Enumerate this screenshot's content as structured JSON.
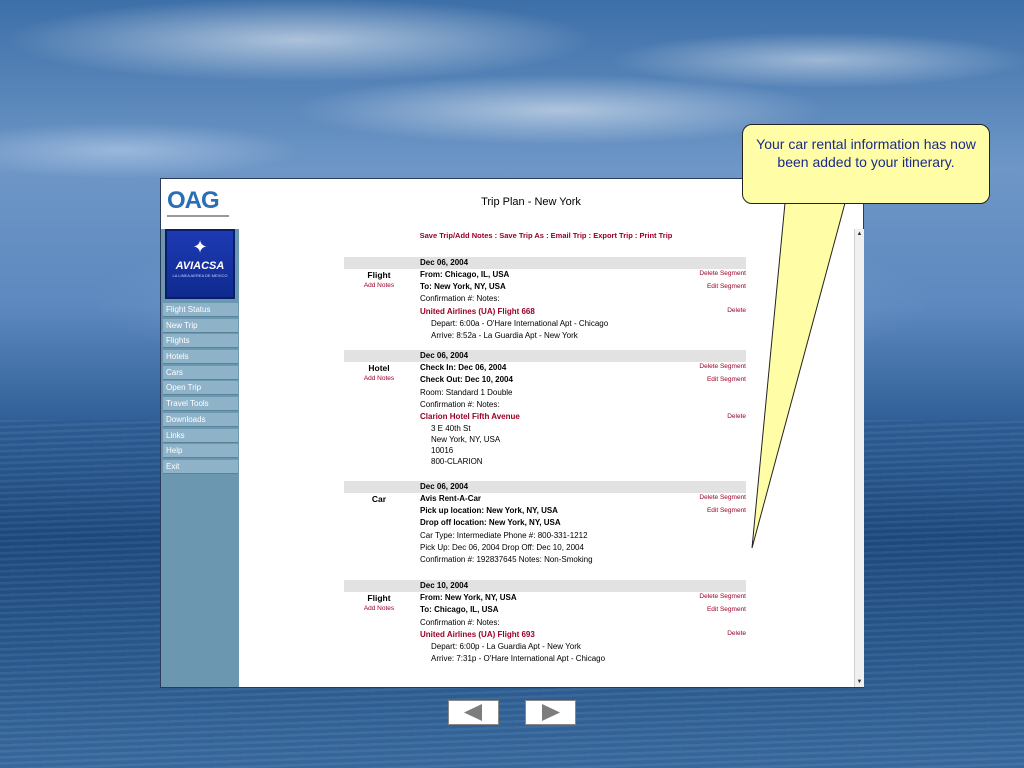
{
  "app": {
    "logo": "OAG",
    "airline": {
      "name": "AVIACSA",
      "tagline": "LA LINEA AEREA DE MEXICO"
    },
    "title": "Trip Plan - New York",
    "nav": [
      "Flight Status",
      "New Trip",
      "Flights",
      "Hotels",
      "Cars",
      "Open Trip",
      "Travel Tools",
      "Downloads",
      "Links",
      "Help",
      "Exit"
    ],
    "actions": [
      "Save Trip/Add Notes",
      "Save Trip As",
      "Email Trip",
      "Export Trip",
      "Print Trip"
    ],
    "action_sep": " : "
  },
  "segments": [
    {
      "date": "Dec 06, 2004",
      "type": "Flight",
      "add_notes": "Add Notes",
      "lines": [
        "From: Chicago, IL, USA",
        "To: New York, NY, USA",
        "Confirmation #:  Notes:",
        "United Airlines (UA) Flight 668",
        "Depart: 6:00a - O'Hare International Apt - Chicago",
        "Arrive: 8:52a  - La Guardia Apt - New York"
      ],
      "links": [
        "Delete Segment",
        "Edit Segment",
        "Delete"
      ]
    },
    {
      "date": "Dec 06, 2004",
      "type": "Hotel",
      "add_notes": "Add Notes",
      "lines": [
        "Check In:  Dec 06, 2004",
        "Check Out:  Dec 10, 2004",
        "Room: Standard 1 Double",
        "Confirmation #:  Notes:",
        "Clarion Hotel Fifth Avenue",
        "3 E 40th St",
        "New York, NY, USA",
        "10016",
        "800-CLARION"
      ],
      "links": [
        "Delete Segment",
        "Edit Segment",
        "Delete"
      ]
    },
    {
      "date": "Dec 06, 2004",
      "type": "Car",
      "lines": [
        "Avis Rent-A-Car",
        "Pick up location: New York, NY, USA",
        "Drop off location: New York, NY, USA",
        "Car Type: Intermediate     Phone #: 800-331-1212",
        "Pick Up:  Dec 06, 2004    Drop Off:  Dec 10, 2004",
        "Confirmation #: 192837645 Notes: Non-Smoking"
      ],
      "links": [
        "Delete Segment",
        "Edit Segment"
      ]
    },
    {
      "date": "Dec 10, 2004",
      "type": "Flight",
      "add_notes": "Add Notes",
      "lines": [
        "From: New York, NY, USA",
        "To: Chicago, IL, USA",
        "Confirmation #:  Notes:",
        "United Airlines (UA) Flight 693",
        "Depart: 6:00p - La Guardia Apt - New York",
        "Arrive: 7:31p  - O'Hare International Apt - Chicago"
      ],
      "links": [
        "Delete Segment",
        "Edit Segment",
        "Delete"
      ]
    }
  ],
  "callout": {
    "text": "Your car rental information has now been added to your itinerary."
  },
  "slide_nav": {
    "prev_icon": "prev-arrow-icon",
    "next_icon": "next-arrow-icon"
  }
}
